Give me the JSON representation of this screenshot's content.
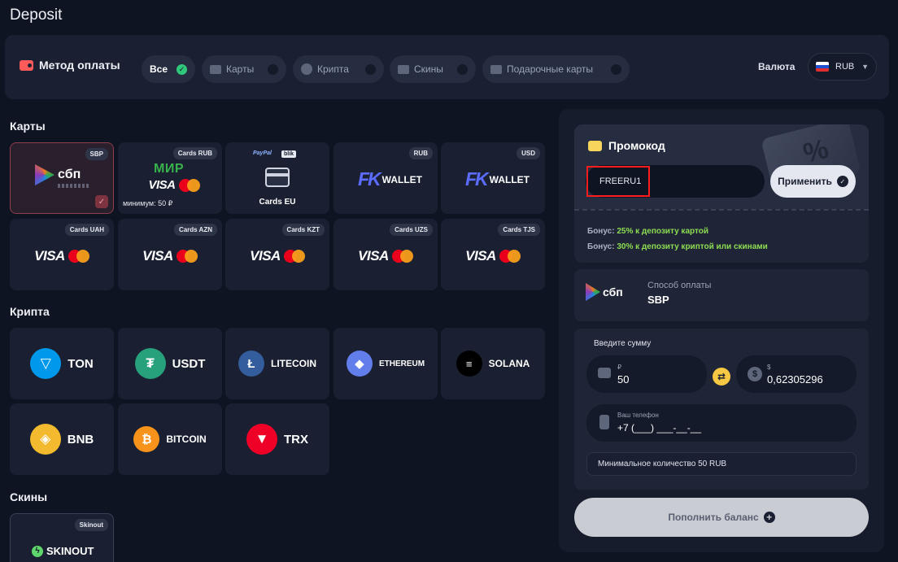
{
  "page": {
    "title": "Deposit"
  },
  "methods_bar": {
    "label": "Метод оплаты",
    "chips": [
      {
        "label": "Все",
        "active": true
      },
      {
        "label": "Карты",
        "active": false
      },
      {
        "label": "Крипта",
        "active": false
      },
      {
        "label": "Скины",
        "active": false
      },
      {
        "label": "Подарочные карты",
        "active": false
      }
    ],
    "currency_label": "Валюта",
    "currency_value": "RUB"
  },
  "sections": {
    "cards": "Карты",
    "crypto": "Крипта",
    "skins": "Скины"
  },
  "cards": [
    {
      "tag": "SBP",
      "brand": "сбп",
      "selected": true
    },
    {
      "tag": "Cards RUB",
      "brand": "МИР",
      "note": "минимум: 50 ₽"
    },
    {
      "tag": "",
      "brand": "Cards EU",
      "paypal": "PayPal",
      "blik": "blik"
    },
    {
      "tag": "RUB",
      "brand": "WALLET",
      "mark": "FK"
    },
    {
      "tag": "USD",
      "brand": "WALLET",
      "mark": "FK"
    },
    {
      "tag": "Cards UAH",
      "brand": "VISA"
    },
    {
      "tag": "Cards AZN",
      "brand": "VISA"
    },
    {
      "tag": "Cards KZT",
      "brand": "VISA"
    },
    {
      "tag": "Cards UZS",
      "brand": "VISA"
    },
    {
      "tag": "Cards TJS",
      "brand": "VISA"
    }
  ],
  "crypto": [
    {
      "name": "TON",
      "color": "#0098ea"
    },
    {
      "name": "USDT",
      "color": "#26a17b"
    },
    {
      "name": "LITECOIN",
      "color": "#345d9d"
    },
    {
      "name": "ETHEREUM",
      "color": "#627eea"
    },
    {
      "name": "SOLANA",
      "color": "#000000"
    },
    {
      "name": "BNB",
      "color": "#f3ba2f"
    },
    {
      "name": "BITCOIN",
      "color": "#f7931a"
    },
    {
      "name": "TRX",
      "color": "#ef0027"
    }
  ],
  "skins": [
    {
      "tag": "Skinout",
      "name": "SKINOUT"
    }
  ],
  "promo": {
    "title": "Промокод",
    "code": "FREERU1",
    "apply_label": "Применить",
    "bonus_prefix": "Бонус: ",
    "bonus_1": "25% к депозиту картой",
    "bonus_2": "30% к депозиту криптой или скинами"
  },
  "payment_method": {
    "caption": "Способ оплаты",
    "value": "SBP",
    "logo": "сбп"
  },
  "amount": {
    "title": "Введите сумму",
    "rub_symbol": "₽",
    "rub_value": "50",
    "usd_symbol": "$",
    "usd_value": "0,62305296",
    "phone_caption": "Ваш телефон",
    "phone_value": "+7 (___) ___-__-__",
    "minimum_note": "Минимальное количество 50 RUB"
  },
  "submit": {
    "label": "Пополнить баланс"
  }
}
